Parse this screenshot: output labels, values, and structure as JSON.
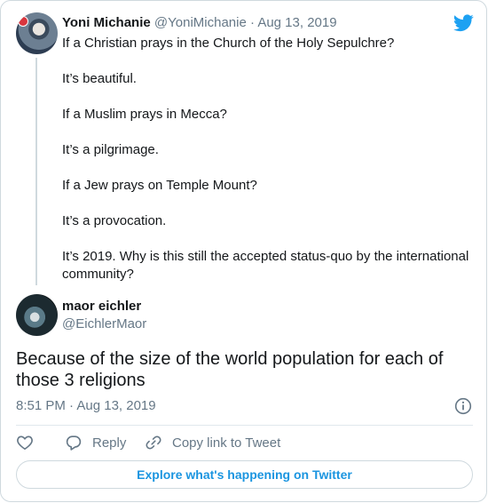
{
  "parent_tweet": {
    "name": "Yoni Michanie",
    "handle": "@YoniMichanie",
    "separator": "·",
    "date": "Aug 13, 2019",
    "lines": [
      "If a Christian prays in the Church of the Holy Sepulchre?",
      "It’s beautiful.",
      "If a Muslim prays in Mecca?",
      "It’s a pilgrimage.",
      "If a Jew prays on Temple Mount?",
      "It’s a provocation.",
      "It’s 2019. Why is this still the accepted status-quo by the international community?"
    ]
  },
  "reply_tweet": {
    "name": "maor eichler",
    "handle": "@EichlerMaor",
    "text": "Because of the size of the world population for each of those 3 religions",
    "timestamp": "8:51 PM · Aug 13, 2019"
  },
  "actions": {
    "reply_label": "Reply",
    "copy_link_label": "Copy link to Tweet"
  },
  "explore_label": "Explore what's happening on Twitter",
  "icons": {
    "brand": "twitter-bird-icon",
    "info": "info-icon",
    "like": "heart-icon",
    "reply": "reply-icon",
    "copy_link": "link-icon"
  },
  "colors": {
    "twitter_blue": "#1da1f2",
    "link_blue": "#1b95e0",
    "secondary_text": "#657786",
    "border": "#cfd9de"
  }
}
